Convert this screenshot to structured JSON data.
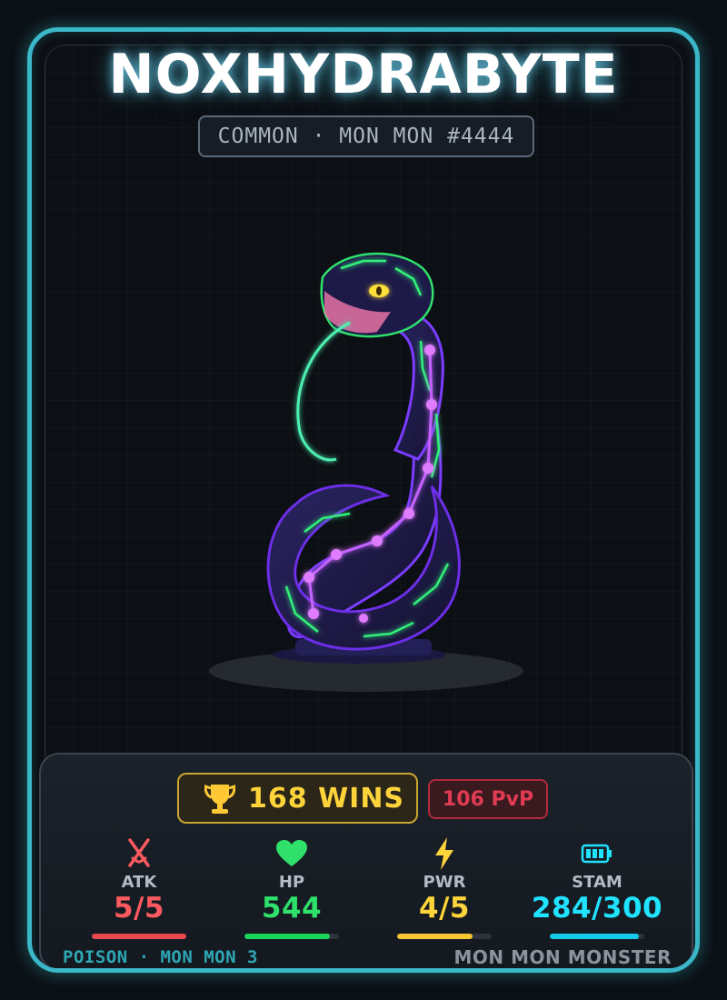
{
  "card": {
    "name": "NOXHYDRABYTE",
    "rarity_line": "COMMON · MON MON #4444",
    "wins_label": "168 WINS",
    "pvp_label": "106 PvP",
    "stats": [
      {
        "label": "ATK",
        "value": "5/5",
        "fill": 1.0,
        "color": "#ff5a5f",
        "bar_color": "#e9494e",
        "icon": "sword-clash-icon"
      },
      {
        "label": "HP",
        "value": "544",
        "fill": 0.9,
        "color": "#2fe06b",
        "bar_color": "#19d45a",
        "icon": "heart-icon"
      },
      {
        "label": "PWR",
        "value": "4/5",
        "fill": 0.8,
        "color": "#ffd43b",
        "bar_color": "#f5c631",
        "icon": "lightning-icon"
      },
      {
        "label": "STAM",
        "value": "284/300",
        "fill": 0.9467,
        "color": "#1fe3ff",
        "bar_color": "#16c9ea",
        "icon": "battery-icon"
      }
    ],
    "footer_left": "POISON · MON MON 3",
    "footer_right": "MON MON MONSTER"
  },
  "colors": {
    "card_border": "#3ab7c8",
    "trophy": "#ffc936"
  }
}
